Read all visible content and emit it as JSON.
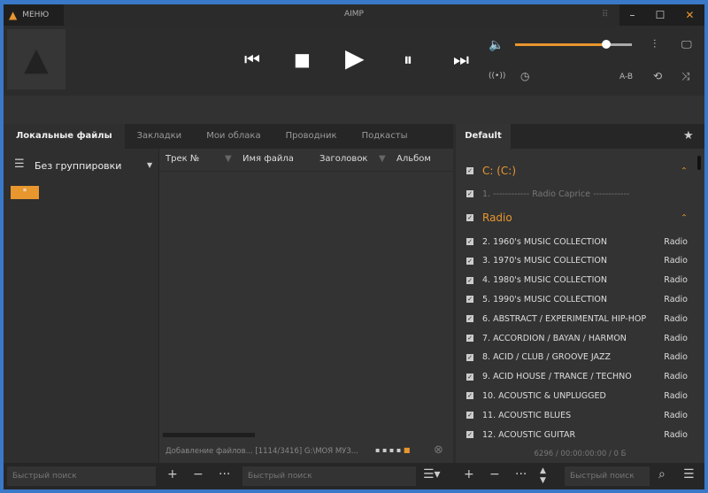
{
  "title": {
    "app": "AIMP",
    "menu": "МЕНЮ"
  },
  "volume": {
    "level": 0.78,
    "accent": "#e8962e"
  },
  "controls": {
    "ab": "A-B"
  },
  "tabs": [
    "Локальные файлы",
    "Закладки",
    "Мои облака",
    "Проводник",
    "Подкасты"
  ],
  "left": {
    "grouping": "Без группировки",
    "star": "*",
    "search_placeholder": "Быстрый поиск"
  },
  "columns": [
    "Трек №",
    "Имя файла",
    "Заголовок",
    "Альбом"
  ],
  "status": {
    "adding": "Добавление файлов... [1114/3416] G:\\МОЯ МУЗ...",
    "search_placeholder": "Быстрый поиск"
  },
  "playlist": {
    "tab": "Default",
    "groups": [
      {
        "name": "C: (C:)"
      },
      {
        "name": "Radio"
      }
    ],
    "item1": "1. ------------ Radio Caprice ------------",
    "items": [
      {
        "title": "2. 1960's MUSIC COLLECTION",
        "src": "Radio"
      },
      {
        "title": "3. 1970's MUSIC COLLECTION",
        "src": "Radio"
      },
      {
        "title": "4. 1980's MUSIC COLLECTION",
        "src": "Radio"
      },
      {
        "title": "5. 1990's MUSIC COLLECTION",
        "src": "Radio"
      },
      {
        "title": "6. ABSTRACT / EXPERIMENTAL HIP-HOP",
        "src": "Radio"
      },
      {
        "title": "7. ACCORDION / BAYAN / HARMON",
        "src": "Radio"
      },
      {
        "title": "8. ACID / CLUB / GROOVE JAZZ",
        "src": "Radio"
      },
      {
        "title": "9. ACID HOUSE / TRANCE / TECHNO",
        "src": "Radio"
      },
      {
        "title": "10. ACOUSTIC & UNPLUGGED",
        "src": "Radio"
      },
      {
        "title": "11. ACOUSTIC BLUES",
        "src": "Radio"
      },
      {
        "title": "12. ACOUSTIC GUITAR",
        "src": "Radio"
      }
    ],
    "summary": "6296 / 00:00:00:00 / 0 Б",
    "search_placeholder": "Быстрый поиск"
  }
}
